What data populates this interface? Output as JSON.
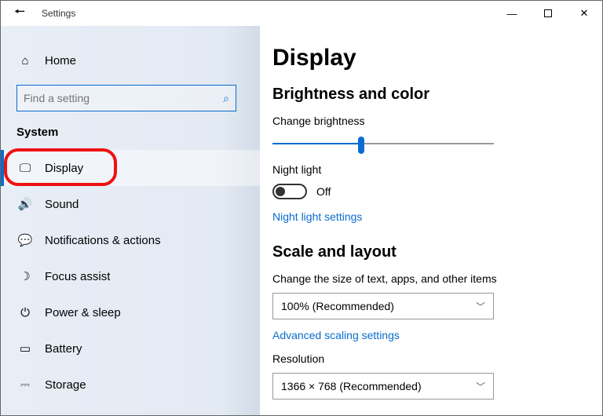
{
  "titlebar": {
    "title": "Settings"
  },
  "sidebar": {
    "home": "Home",
    "search_placeholder": "Find a setting",
    "category": "System",
    "items": [
      {
        "label": "Display"
      },
      {
        "label": "Sound"
      },
      {
        "label": "Notifications & actions"
      },
      {
        "label": "Focus assist"
      },
      {
        "label": "Power & sleep"
      },
      {
        "label": "Battery"
      },
      {
        "label": "Storage"
      }
    ]
  },
  "main": {
    "heading": "Display",
    "section1": "Brightness and color",
    "brightness_label": "Change brightness",
    "nightlight_label": "Night light",
    "nightlight_state": "Off",
    "nightlight_link": "Night light settings",
    "section2": "Scale and layout",
    "scale_label": "Change the size of text, apps, and other items",
    "scale_value": "100% (Recommended)",
    "scaling_link": "Advanced scaling settings",
    "resolution_label": "Resolution",
    "resolution_value": "1366 × 768 (Recommended)"
  }
}
